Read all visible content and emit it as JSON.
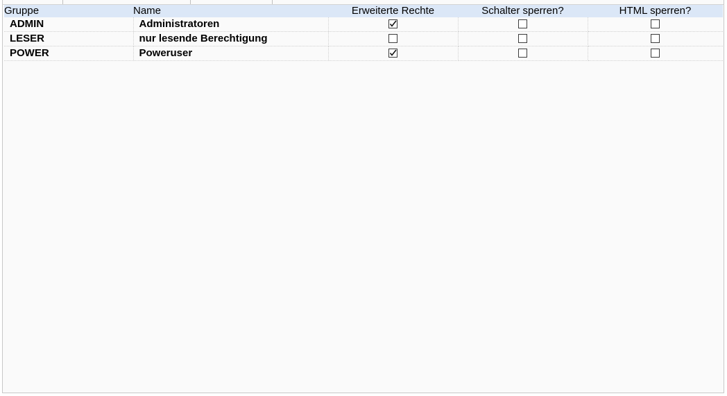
{
  "grid": {
    "columns": [
      "Gruppe",
      "Name",
      "Erweiterte Rechte",
      "Schalter sperren?",
      "HTML sperren?"
    ],
    "rows": [
      {
        "group": "ADMIN",
        "name": "Administratoren",
        "extended_rights": true,
        "lock_buttons": false,
        "lock_html": false
      },
      {
        "group": "LESER",
        "name": "nur lesende Berechtigung",
        "extended_rights": false,
        "lock_buttons": false,
        "lock_html": false
      },
      {
        "group": "POWER",
        "name": "Poweruser",
        "extended_rights": true,
        "lock_buttons": false,
        "lock_html": false
      }
    ]
  }
}
